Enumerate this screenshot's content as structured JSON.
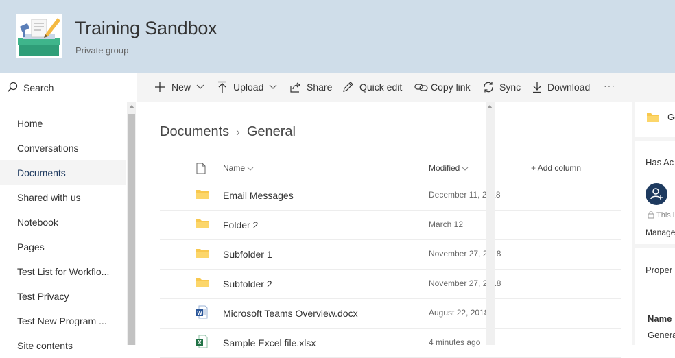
{
  "site": {
    "title": "Training Sandbox",
    "subtitle": "Private group",
    "logo_icon": "group-logo-icon"
  },
  "search": {
    "label": "Search",
    "icon": "search-icon"
  },
  "nav": {
    "items": [
      {
        "label": "Home"
      },
      {
        "label": "Conversations"
      },
      {
        "label": "Documents",
        "selected": true
      },
      {
        "label": "Shared with us"
      },
      {
        "label": "Notebook"
      },
      {
        "label": "Pages"
      },
      {
        "label": "Test List for Workflo..."
      },
      {
        "label": "Test Privacy"
      },
      {
        "label": "Test New Program ..."
      },
      {
        "label": "Site contents"
      }
    ]
  },
  "toolbar": {
    "new": "New",
    "upload": "Upload",
    "share": "Share",
    "quick_edit": "Quick edit",
    "copy_link": "Copy link",
    "sync": "Sync",
    "download": "Download",
    "more": "···"
  },
  "breadcrumb": {
    "root": "Documents",
    "current": "General"
  },
  "columns": {
    "name": "Name",
    "modified": "Modified",
    "add_column": "Add column"
  },
  "files": [
    {
      "name": "Email Messages",
      "modified": "December 11, 2018",
      "type": "folder"
    },
    {
      "name": "Folder 2",
      "modified": "March 12",
      "type": "folder"
    },
    {
      "name": "Subfolder 1",
      "modified": "November 27, 2018",
      "type": "folder"
    },
    {
      "name": "Subfolder 2",
      "modified": "November 27, 2018",
      "type": "folder"
    },
    {
      "name": "Microsoft Teams Overview.docx",
      "modified": "August 22, 2018",
      "type": "word"
    },
    {
      "name": "Sample Excel file.xlsx",
      "modified": "4 minutes ago",
      "type": "excel"
    }
  ],
  "details_panel": {
    "folder_name": "Ge",
    "has_access": "Has Ac",
    "privacy_note": "This i",
    "manage": "Manage",
    "properties": "Proper",
    "name_label": "Name",
    "name_value": "Genera"
  },
  "colors": {
    "header_bg": "#cfdde9",
    "accent": "#1e3a5f",
    "folder": "#f8c84e",
    "word": "#2b579a",
    "excel": "#217346"
  }
}
